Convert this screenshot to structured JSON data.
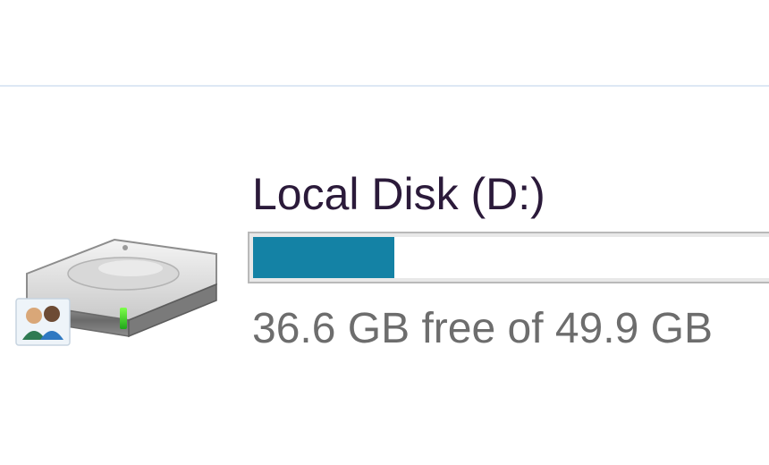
{
  "drive": {
    "name": "Local Disk (D:)",
    "space_text": "36.6 GB free of 49.9 GB",
    "used_fraction": 0.267,
    "icon": "hard-drive-icon",
    "overlay_icon": "shared-users-icon",
    "accent_color": "#1482a5"
  }
}
